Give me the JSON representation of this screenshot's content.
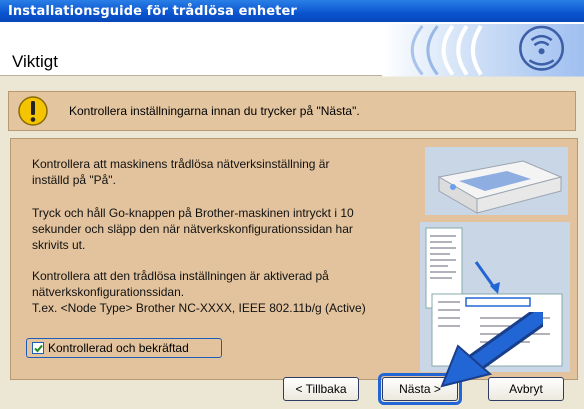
{
  "window": {
    "title": "Installationsguide för trådlösa enheter"
  },
  "header": {
    "title": "Viktigt",
    "logo_icon": "wireless-wifi-icon"
  },
  "warning": {
    "icon": "exclamation-warning-icon",
    "text": "Kontrollera inställningarna innan du trycker på \"Nästa\"."
  },
  "content": {
    "para1_l1": "Kontrollera att maskinens trådlösa nätverksinställning är",
    "para1_l2": "inställd på \"På\".",
    "para2_l1": "Tryck och håll Go-knappen på Brother-maskinen intryckt i 10",
    "para2_l2": "sekunder och släpp den när nätverkskonfigurationssidan har",
    "para2_l3": "skrivits ut.",
    "para3_l1": "Kontrollera att den trådlösa inställningen är aktiverad på",
    "para3_l2": "nätverkskonfigurationssidan.",
    "para3_l3": "T.ex. <Node Type> Brother NC-XXXX, IEEE 802.11b/g (Active)",
    "images": [
      "printer-illustration",
      "network-config-page-illustration"
    ]
  },
  "checkbox": {
    "label": "Kontrollerad och bekräftad",
    "checked": true
  },
  "buttons": {
    "back": "< Tillbaka",
    "next": "Nästa >",
    "cancel": "Avbryt"
  },
  "colors": {
    "titlebar": "#0a54d0",
    "panel": "#e2c39d",
    "accent": "#2266d6"
  }
}
